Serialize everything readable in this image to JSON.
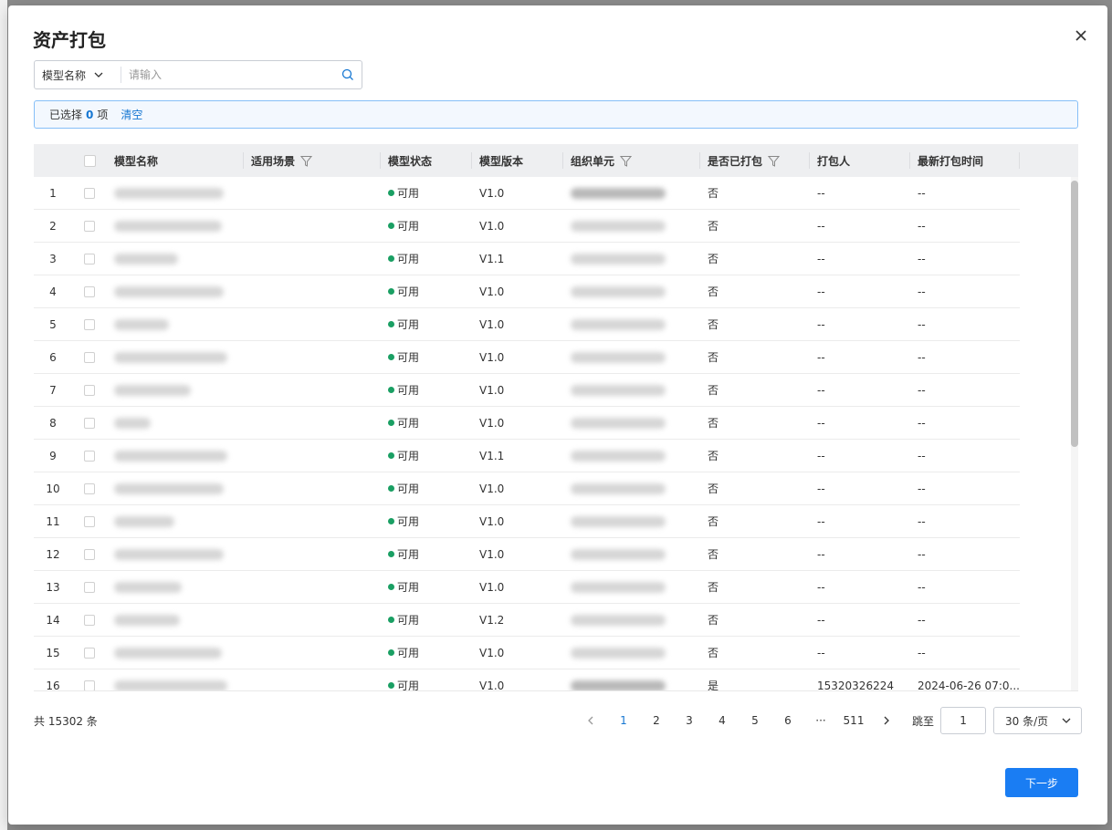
{
  "modal": {
    "title": "资产打包",
    "next_label": "下一步"
  },
  "search": {
    "type_label": "模型名称",
    "placeholder": "请输入"
  },
  "selection": {
    "prefix": "已选择",
    "count": "0",
    "suffix": "项",
    "clear_label": "清空"
  },
  "table": {
    "columns": [
      "模型名称",
      "适用场景",
      "模型状态",
      "模型版本",
      "组织单元",
      "是否已打包",
      "打包人",
      "最新打包时间"
    ],
    "rows": [
      {
        "idx": "1",
        "status": "可用",
        "version": "V1.0",
        "packed": "否",
        "packer": "--",
        "time": "--"
      },
      {
        "idx": "2",
        "status": "可用",
        "version": "V1.0",
        "packed": "否",
        "packer": "--",
        "time": "--"
      },
      {
        "idx": "3",
        "status": "可用",
        "version": "V1.1",
        "packed": "否",
        "packer": "--",
        "time": "--"
      },
      {
        "idx": "4",
        "status": "可用",
        "version": "V1.0",
        "packed": "否",
        "packer": "--",
        "time": "--"
      },
      {
        "idx": "5",
        "status": "可用",
        "version": "V1.0",
        "packed": "否",
        "packer": "--",
        "time": "--"
      },
      {
        "idx": "6",
        "status": "可用",
        "version": "V1.0",
        "packed": "否",
        "packer": "--",
        "time": "--"
      },
      {
        "idx": "7",
        "status": "可用",
        "version": "V1.0",
        "packed": "否",
        "packer": "--",
        "time": "--"
      },
      {
        "idx": "8",
        "status": "可用",
        "version": "V1.0",
        "packed": "否",
        "packer": "--",
        "time": "--"
      },
      {
        "idx": "9",
        "status": "可用",
        "version": "V1.1",
        "packed": "否",
        "packer": "--",
        "time": "--"
      },
      {
        "idx": "10",
        "status": "可用",
        "version": "V1.0",
        "packed": "否",
        "packer": "--",
        "time": "--"
      },
      {
        "idx": "11",
        "status": "可用",
        "version": "V1.0",
        "packed": "否",
        "packer": "--",
        "time": "--"
      },
      {
        "idx": "12",
        "status": "可用",
        "version": "V1.0",
        "packed": "否",
        "packer": "--",
        "time": "--"
      },
      {
        "idx": "13",
        "status": "可用",
        "version": "V1.0",
        "packed": "否",
        "packer": "--",
        "time": "--"
      },
      {
        "idx": "14",
        "status": "可用",
        "version": "V1.2",
        "packed": "否",
        "packer": "--",
        "time": "--"
      },
      {
        "idx": "15",
        "status": "可用",
        "version": "V1.0",
        "packed": "否",
        "packer": "--",
        "time": "--"
      },
      {
        "idx": "16",
        "status": "可用",
        "version": "V1.0",
        "packed": "是",
        "packer": "15320326224",
        "time": "2024-06-26 07:0..."
      }
    ]
  },
  "pagination": {
    "total_text": "共 15302 条",
    "pages": [
      "1",
      "2",
      "3",
      "4",
      "5",
      "6"
    ],
    "ellipsis": "···",
    "last_page": "511",
    "current_page": "1",
    "jump_label": "跳至",
    "jump_value": "1",
    "page_size": "30 条/页"
  },
  "colors": {
    "accent": "#1a7df3",
    "status_available": "#1a9f63",
    "selection_bg": "#f3f8fe"
  }
}
